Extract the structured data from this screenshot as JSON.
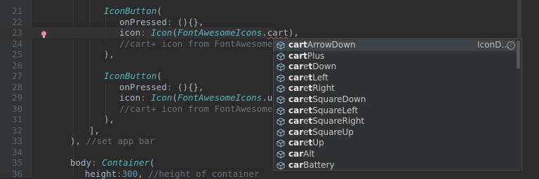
{
  "editor": {
    "lines": [
      {
        "num": "21",
        "indent": 148,
        "tokens": [
          {
            "t": "IconButton",
            "c": "k-cls"
          },
          {
            "t": "(",
            "c": "k-plain"
          }
        ]
      },
      {
        "num": "22",
        "indent": 170,
        "tokens": [
          {
            "t": "onPressed",
            "c": "k-param"
          },
          {
            "t": ": ",
            "c": "k-colon"
          },
          {
            "t": "(){},",
            "c": "k-plain"
          }
        ]
      },
      {
        "num": "23",
        "indent": 170,
        "caret": true,
        "tokens": [
          {
            "t": "icon",
            "c": "k-param"
          },
          {
            "t": ": ",
            "c": "k-colon"
          },
          {
            "t": "Icon",
            "c": "k-fn"
          },
          {
            "t": "(",
            "c": "k-plain"
          },
          {
            "t": "FontAwesomeIcons",
            "c": "k-cls"
          },
          {
            "t": ".",
            "c": "k-plain"
          },
          {
            "t": "cart",
            "c": "k-plain squiggle"
          },
          {
            "t": "),",
            "c": "k-plain"
          }
        ]
      },
      {
        "num": "24",
        "indent": 170,
        "tokens": [
          {
            "t": "//cart+ icon from FontAwesome",
            "c": "k-cmt"
          }
        ]
      },
      {
        "num": "25",
        "indent": 148,
        "tokens": [
          {
            "t": "),",
            "c": "k-plain"
          }
        ]
      },
      {
        "num": "26",
        "indent": 148,
        "tokens": []
      },
      {
        "num": "27",
        "indent": 148,
        "tokens": [
          {
            "t": "IconButton",
            "c": "k-cls"
          },
          {
            "t": "(",
            "c": "k-plain"
          }
        ]
      },
      {
        "num": "28",
        "indent": 170,
        "tokens": [
          {
            "t": "onPressed",
            "c": "k-param"
          },
          {
            "t": ": ",
            "c": "k-colon"
          },
          {
            "t": "(){},",
            "c": "k-plain"
          }
        ]
      },
      {
        "num": "29",
        "indent": 170,
        "tokens": [
          {
            "t": "icon",
            "c": "k-param"
          },
          {
            "t": ": ",
            "c": "k-colon"
          },
          {
            "t": "Icon",
            "c": "k-fn"
          },
          {
            "t": "(",
            "c": "k-plain"
          },
          {
            "t": "FontAwesomeIcons",
            "c": "k-cls"
          },
          {
            "t": ".user",
            "c": "k-plain"
          }
        ]
      },
      {
        "num": "30",
        "indent": 170,
        "tokens": [
          {
            "t": "//cart+ icon from FontAwesome",
            "c": "k-cmt"
          }
        ]
      },
      {
        "num": "31",
        "indent": 148,
        "tokens": [
          {
            "t": "),",
            "c": "k-plain"
          }
        ]
      },
      {
        "num": "32",
        "indent": 127,
        "tokens": [
          {
            "t": "],",
            "c": "k-plain"
          }
        ]
      },
      {
        "num": "33",
        "indent": 100,
        "tokens": [
          {
            "t": "), ",
            "c": "k-plain"
          },
          {
            "t": "//set app bar",
            "c": "k-cmt"
          }
        ]
      },
      {
        "num": "34",
        "indent": 100,
        "tokens": []
      },
      {
        "num": "35",
        "indent": 100,
        "tokens": [
          {
            "t": "body",
            "c": "k-param"
          },
          {
            "t": ": ",
            "c": "k-colon"
          },
          {
            "t": "Container",
            "c": "k-cls"
          },
          {
            "t": "(",
            "c": "k-plain"
          }
        ]
      },
      {
        "num": "36",
        "indent": 121,
        "tokens": [
          {
            "t": "height",
            "c": "k-param"
          },
          {
            "t": ":",
            "c": "k-colon"
          },
          {
            "t": "300",
            "c": "k-num"
          },
          {
            "t": ", ",
            "c": "k-plain"
          },
          {
            "t": "//height of container",
            "c": "k-cmt"
          }
        ]
      }
    ]
  },
  "autocomplete": {
    "type_label": "IconD…",
    "info_glyph": "i",
    "items": [
      {
        "bold": "cart",
        "rest": "ArrowDown",
        "selected": true
      },
      {
        "bold": "cart",
        "rest": "Plus"
      },
      {
        "bold": "car",
        "rest": "e",
        "bold2": "t",
        "rest2": "Down"
      },
      {
        "bold": "car",
        "rest": "e",
        "bold2": "t",
        "rest2": "Left"
      },
      {
        "bold": "car",
        "rest": "e",
        "bold2": "t",
        "rest2": "Right"
      },
      {
        "bold": "car",
        "rest": "e",
        "bold2": "t",
        "rest2": "SquareDown"
      },
      {
        "bold": "car",
        "rest": "e",
        "bold2": "t",
        "rest2": "SquareLeft"
      },
      {
        "bold": "car",
        "rest": "e",
        "bold2": "t",
        "rest2": "SquareRight"
      },
      {
        "bold": "car",
        "rest": "e",
        "bold2": "t",
        "rest2": "SquareUp"
      },
      {
        "bold": "car",
        "rest": "e",
        "bold2": "t",
        "rest2": "Up"
      },
      {
        "bold": "car",
        "rest": "Alt"
      },
      {
        "bold": "car",
        "rest": "Battery"
      }
    ]
  },
  "icons": {
    "bulb": "lightbulb-icon",
    "item": "cube-icon"
  },
  "colors": {
    "background": "#2b2b2b",
    "class": "#56b6c2",
    "comment": "#6a737d",
    "number": "#6897bb",
    "keyword": "#cc7832"
  }
}
